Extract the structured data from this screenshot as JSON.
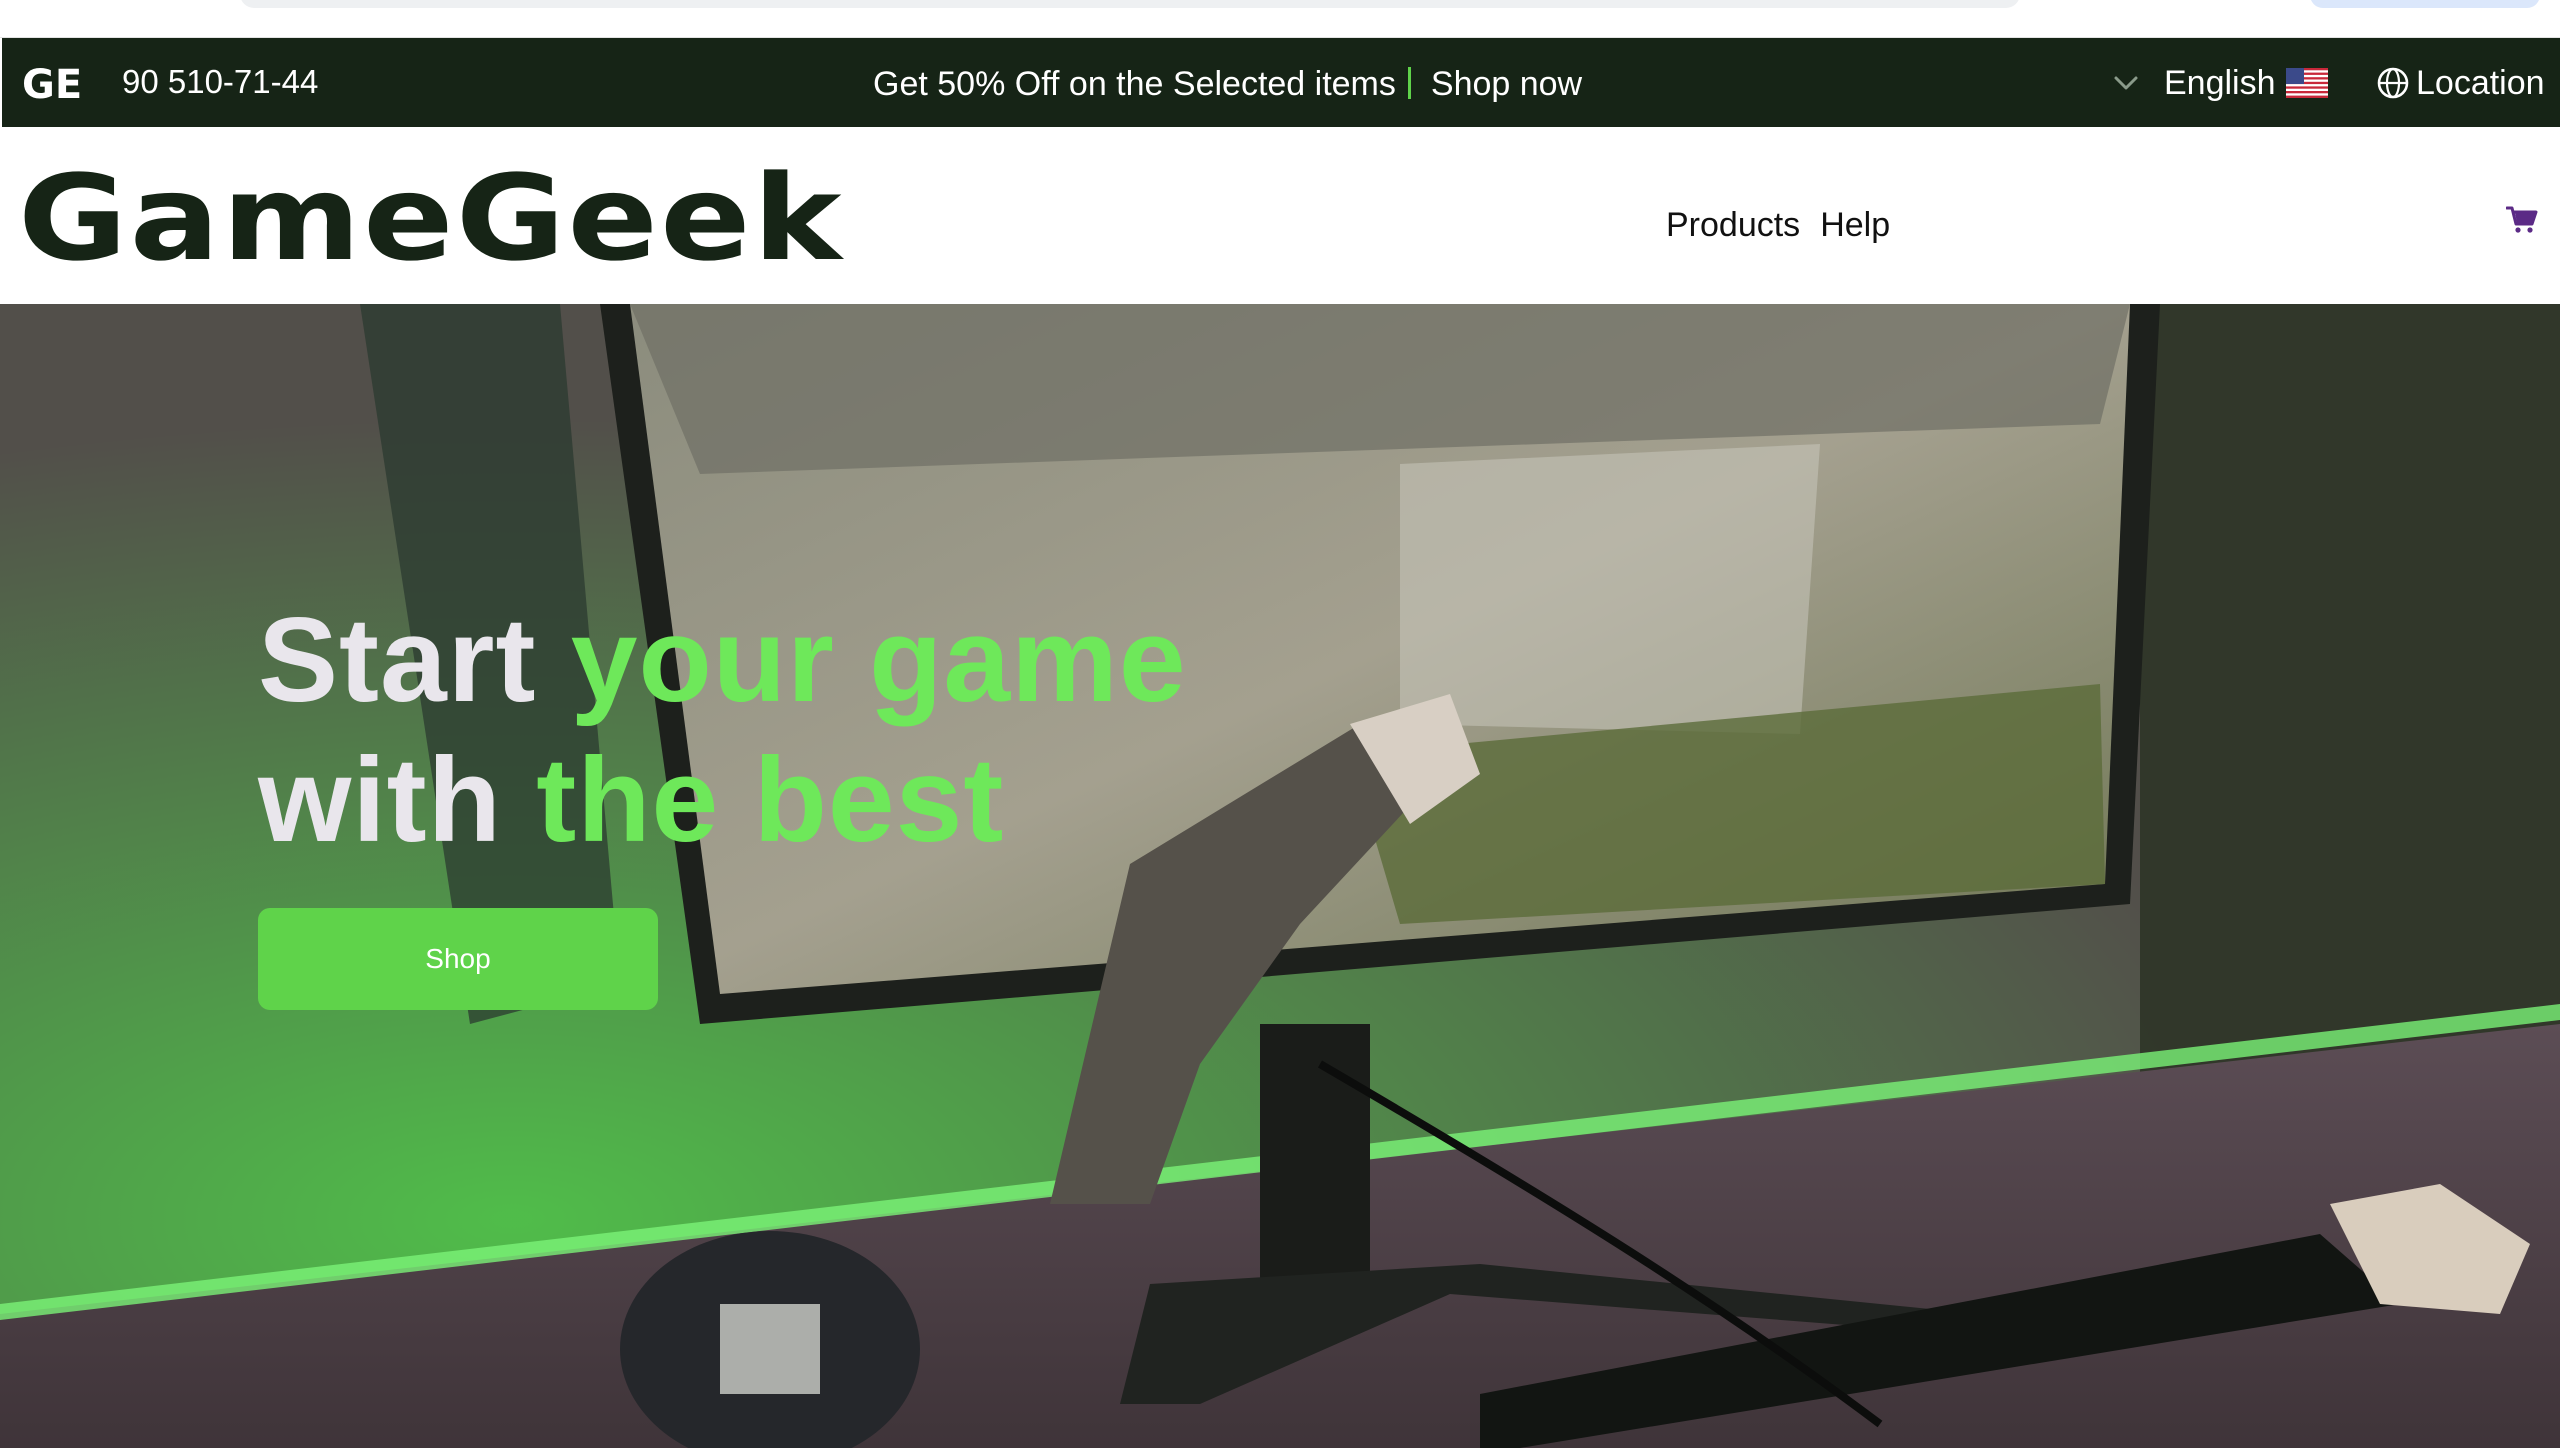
{
  "topbar": {
    "brand_mark": "GE",
    "phone": "90 510-71-44",
    "promo_text": "Get 50% Off on the Selected items",
    "shop_now": "Shop now",
    "language": "English",
    "location": "Location"
  },
  "header": {
    "logo": "GameGeek",
    "nav": [
      "Products",
      "Help"
    ]
  },
  "hero": {
    "title_line1_white": "Start ",
    "title_line1_green": "your game",
    "title_line2_white": "with ",
    "title_line2_green": "the best",
    "shop_button": "Shop"
  },
  "colors": {
    "topbar_bg": "#162416",
    "accent_green": "#5fd34a",
    "headline_green": "#6ee85a",
    "cart_purple": "#5b2a86"
  },
  "icons": [
    "chevron-down-icon",
    "us-flag-icon",
    "globe-icon",
    "cart-icon"
  ]
}
